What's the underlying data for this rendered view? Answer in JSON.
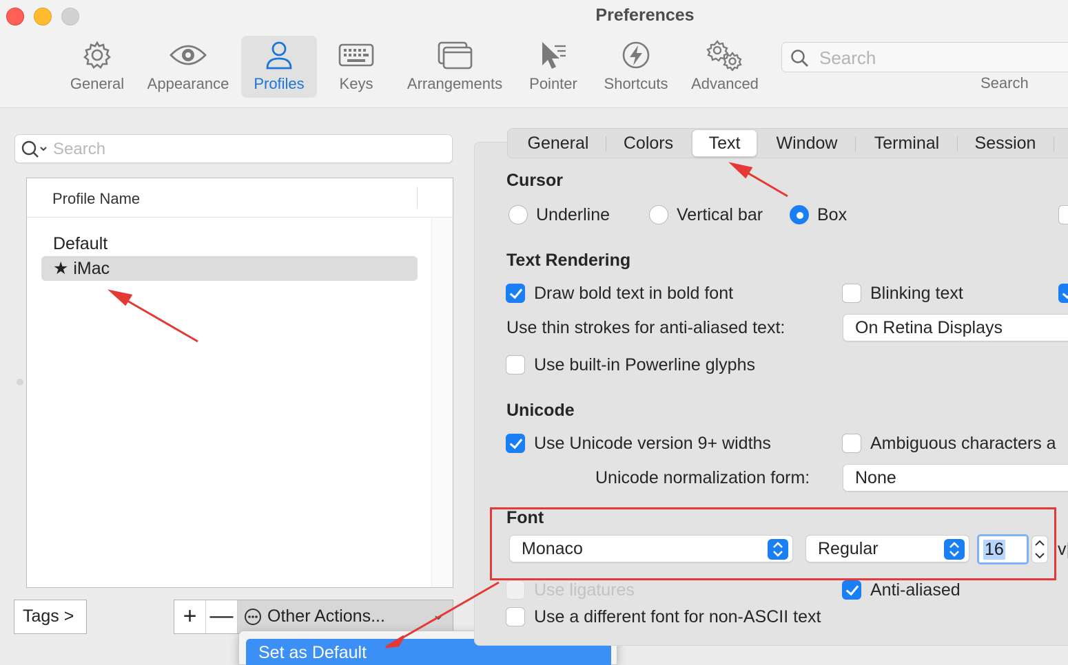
{
  "window": {
    "title": "Preferences"
  },
  "toolbar": {
    "items": [
      {
        "label": "General",
        "icon": "gear-icon"
      },
      {
        "label": "Appearance",
        "icon": "eye-icon"
      },
      {
        "label": "Profiles",
        "icon": "person-icon"
      },
      {
        "label": "Keys",
        "icon": "keyboard-icon"
      },
      {
        "label": "Arrangements",
        "icon": "window-stack-icon"
      },
      {
        "label": "Pointer",
        "icon": "pointer-icon"
      },
      {
        "label": "Shortcuts",
        "icon": "lightning-icon"
      },
      {
        "label": "Advanced",
        "icon": "gears-icon"
      }
    ],
    "active": "Profiles",
    "search_placeholder": "Search",
    "search_label": "Search"
  },
  "profiles": {
    "search_placeholder": "Search",
    "column_header": "Profile Name",
    "items": [
      "Default",
      "★ iMac"
    ],
    "selected": "★ iMac",
    "tags_button": "Tags >",
    "add_button": "+",
    "remove_button": "—",
    "other_actions": "Other Actions...",
    "menu_item": "Set as Default"
  },
  "tabs": {
    "items": [
      "General",
      "Colors",
      "Text",
      "Window",
      "Terminal",
      "Session"
    ],
    "active": "Text"
  },
  "cursor": {
    "title": "Cursor",
    "options": [
      "Underline",
      "Vertical bar",
      "Box"
    ],
    "selected": "Box"
  },
  "text_rendering": {
    "title": "Text Rendering",
    "bold_label": "Draw bold text in bold font",
    "bold_checked": true,
    "blink_label": "Blinking text",
    "blink_checked": false,
    "thin_strokes_label": "Use thin strokes for anti-aliased text:",
    "thin_strokes_value": "On Retina Displays",
    "powerline_label": "Use built-in Powerline glyphs",
    "powerline_checked": false
  },
  "unicode": {
    "title": "Unicode",
    "widths_label": "Use Unicode version 9+ widths",
    "widths_checked": true,
    "ambiguous_label": "Ambiguous characters a",
    "ambiguous_checked": false,
    "normalization_label": "Unicode normalization form:",
    "normalization_value": "None"
  },
  "font": {
    "title": "Font",
    "family": "Monaco",
    "style": "Regular",
    "size": "16",
    "trailing": "v|",
    "ligatures_label": "Use ligatures",
    "ligatures_checked": false,
    "antialiased_label": "Anti-aliased",
    "antialiased_checked": true,
    "non_ascii_label": "Use a different font for non-ASCII text",
    "non_ascii_checked": false
  },
  "colors": {
    "accent": "#1a7ff5",
    "annotation_red": "#e53935",
    "menu_highlight": "#3b8ff5"
  }
}
